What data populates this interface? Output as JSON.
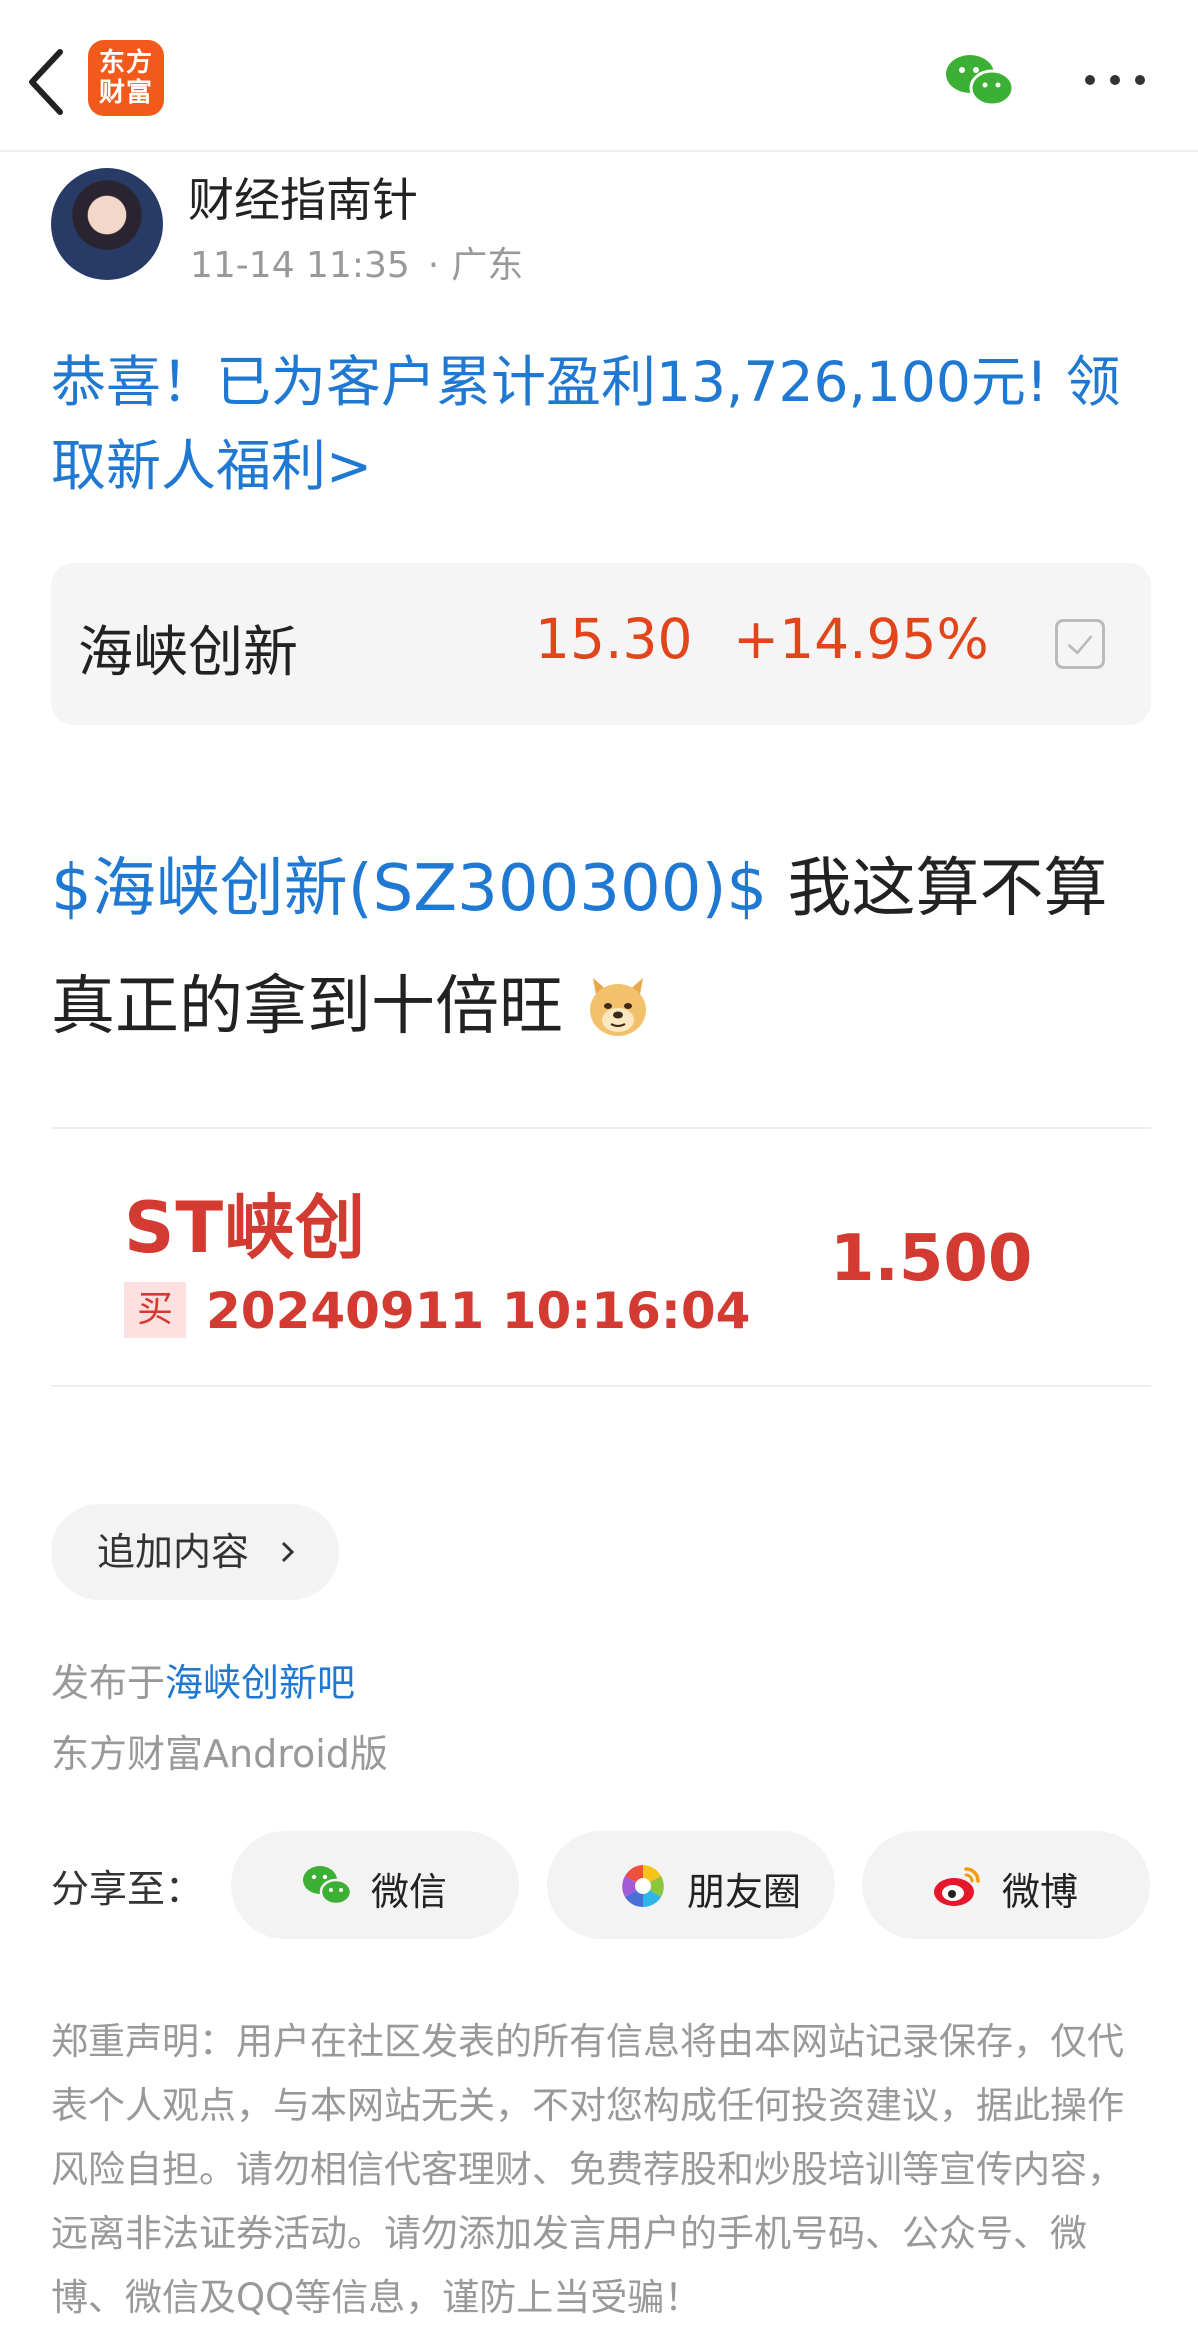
{
  "header": {
    "logo_line1": "东方",
    "logo_line2": "财富"
  },
  "author": {
    "name": "财经指南针",
    "time": "11-14 11:35",
    "location": "广东"
  },
  "promo": {
    "text": "恭喜！已为客户累计盈利13,726,100元! 领取新人福利>"
  },
  "quote": {
    "name": "海峡创新",
    "price": "15.30",
    "change": "+14.95%"
  },
  "post": {
    "stock_link": "$海峡创新(SZ300300)$",
    "text": " 我这算不算真正的拿到十倍旺"
  },
  "trade": {
    "name": "ST峡创",
    "action": "买",
    "datetime": "20240911 10:16:04",
    "price": "1.500"
  },
  "append": {
    "label": "追加内容"
  },
  "published": {
    "prefix": "发布于",
    "forum": "海峡创新吧",
    "source": "东方财富Android版"
  },
  "share": {
    "label": "分享至：",
    "wechat": "微信",
    "moments": "朋友圈",
    "weibo": "微博"
  },
  "disclaimer": {
    "text": "郑重声明：用户在社区发表的所有信息将由本网站记录保存，仅代表个人观点，与本网站无关，不对您构成任何投资建议，据此操作风险自担。请勿相信代客理财、免费荐股和炒股培训等宣传内容，远离非法证券活动。请勿添加发言用户的手机号码、公众号、微博、微信及QQ等信息，谨防上当受骗！"
  },
  "colors": {
    "link_blue": "#1f78d1",
    "price_red": "#e2451a",
    "trade_red": "#d33a31",
    "brand_orange": "#f25a1c",
    "wechat_green": "#3cb034"
  },
  "icons": [
    "back-arrow-icon",
    "eastmoney-logo",
    "wechat-icon",
    "more-icon",
    "checkbox-icon",
    "doge-emoji-icon",
    "chevron-right-icon",
    "moments-icon",
    "weibo-icon"
  ]
}
